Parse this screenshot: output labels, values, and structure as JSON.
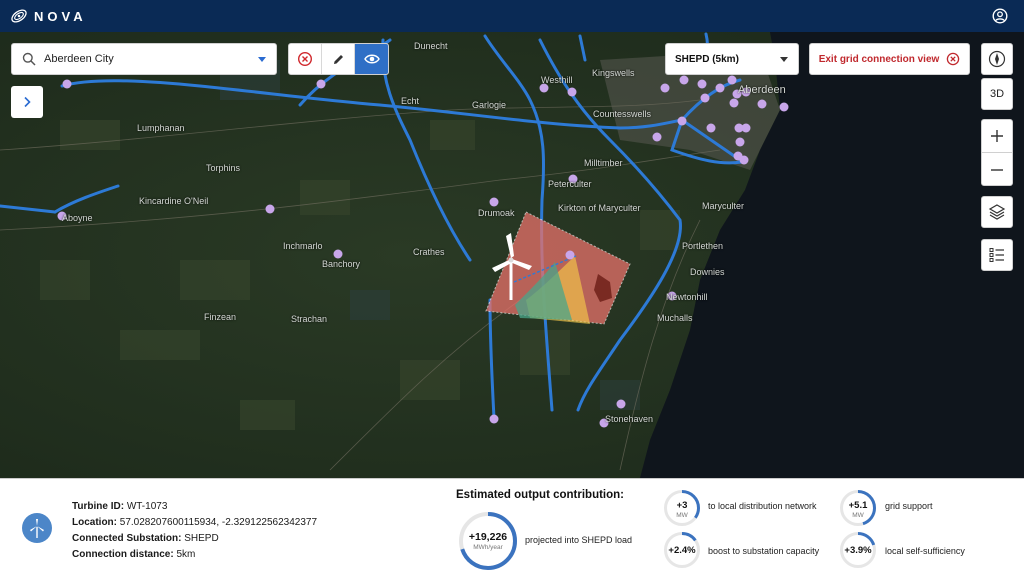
{
  "app": {
    "name": "NOVA"
  },
  "search": {
    "value": "Aberdeen City",
    "placeholder": "Search location"
  },
  "region_select": {
    "selected": "SHEPD (5km)"
  },
  "exit_button": {
    "label": "Exit grid connection view"
  },
  "map_controls": {
    "view_3d": "3D"
  },
  "colors": {
    "topbar": "#0a2a55",
    "accent": "#2f6fc6",
    "powerline": "#2d7ad6",
    "substation": "#c8a6ea",
    "exit_red": "#c0282d"
  },
  "places": [
    {
      "name": "Dunecht"
    },
    {
      "name": "Westhill"
    },
    {
      "name": "Kingswells"
    },
    {
      "name": "Echt"
    },
    {
      "name": "Garlogie"
    },
    {
      "name": "Countesswells"
    },
    {
      "name": "Lumphanan"
    },
    {
      "name": "Torphins"
    },
    {
      "name": "Milltimber"
    },
    {
      "name": "Peterculter"
    },
    {
      "name": "Kincardine O'Neil"
    },
    {
      "name": "Kirkton of Maryculter"
    },
    {
      "name": "Maryculter"
    },
    {
      "name": "Drumoak"
    },
    {
      "name": "Portlethen"
    },
    {
      "name": "Inchmarlo"
    },
    {
      "name": "Crathes"
    },
    {
      "name": "Banchory"
    },
    {
      "name": "Downies"
    },
    {
      "name": "Newtonhill"
    },
    {
      "name": "Finzean"
    },
    {
      "name": "Strachan"
    },
    {
      "name": "Muchalls"
    },
    {
      "name": "Stonehaven"
    },
    {
      "name": "Aboyne"
    },
    {
      "name": "Aberdeen"
    }
  ],
  "turbine": {
    "id_label": "Turbine ID:",
    "id": "WT-1073",
    "location_label": "Location:",
    "location": "57.028207600115934, -2.329122562342377",
    "substation_label": "Connected Substation:",
    "substation": "SHEPD",
    "distance_label": "Connection distance:",
    "distance": "5km"
  },
  "output": {
    "title": "Estimated output contribution:",
    "main": {
      "value": "+19,226",
      "unit": "MWh/year",
      "label": "projected into SHEPD load",
      "fill": 0.7
    },
    "metrics": [
      {
        "value": "+3",
        "unit": "MW",
        "label": "to local distribution network",
        "fill": 0.35
      },
      {
        "value": "+5.1",
        "unit": "MW",
        "label": "grid support",
        "fill": 0.45
      },
      {
        "value": "+2.4%",
        "unit": "",
        "label": "boost to substation capacity",
        "fill": 0.15
      },
      {
        "value": "+3.9%",
        "unit": "",
        "label": "local self-sufficiency",
        "fill": 0.2
      }
    ]
  }
}
